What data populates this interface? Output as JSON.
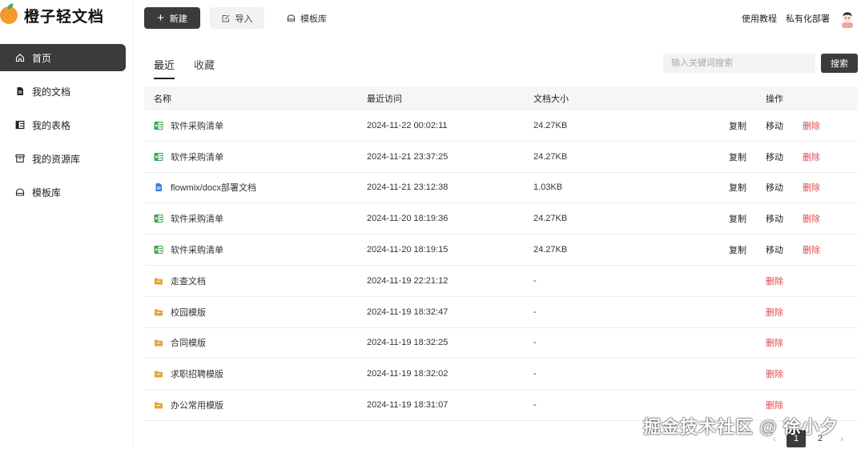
{
  "app": {
    "title": "橙子轻文档"
  },
  "sidebar": {
    "items": [
      {
        "label": "首页",
        "icon": "home-icon",
        "active": true
      },
      {
        "label": "我的文档",
        "icon": "document-icon",
        "active": false
      },
      {
        "label": "我的表格",
        "icon": "sheet-icon",
        "active": false
      },
      {
        "label": "我的资源库",
        "icon": "archive-icon",
        "active": false
      },
      {
        "label": "模板库",
        "icon": "template-icon",
        "active": false
      }
    ]
  },
  "toolbar": {
    "new_label": "新建",
    "import_label": "导入",
    "template_label": "模板库",
    "tutorial_label": "使用教程",
    "private_deploy_label": "私有化部署"
  },
  "tabs": [
    {
      "label": "最近",
      "active": true
    },
    {
      "label": "收藏",
      "active": false
    }
  ],
  "search": {
    "placeholder": "输入关键词搜索",
    "button_label": "搜索"
  },
  "table": {
    "headers": {
      "name": "名称",
      "time": "最近访问",
      "size": "文档大小",
      "ops": "操作"
    },
    "op_labels": {
      "copy": "复制",
      "move": "移动",
      "delete": "删除"
    },
    "rows": [
      {
        "type": "sheet",
        "name": "软件采购清单",
        "time": "2024-11-22 00:02:11",
        "size": "24.27KB",
        "full_ops": true
      },
      {
        "type": "sheet",
        "name": "软件采购清单",
        "time": "2024-11-21 23:37:25",
        "size": "24.27KB",
        "full_ops": true
      },
      {
        "type": "doc",
        "name": "flowmix/docx部署文档",
        "time": "2024-11-21 23:12:38",
        "size": "1.03KB",
        "full_ops": true
      },
      {
        "type": "sheet",
        "name": "软件采购清单",
        "time": "2024-11-20 18:19:36",
        "size": "24.27KB",
        "full_ops": true
      },
      {
        "type": "sheet",
        "name": "软件采购清单",
        "time": "2024-11-20 18:19:15",
        "size": "24.27KB",
        "full_ops": true
      },
      {
        "type": "folder",
        "name": "走查文档",
        "time": "2024-11-19 22:21:12",
        "size": "-",
        "full_ops": false
      },
      {
        "type": "folder",
        "name": "校园模版",
        "time": "2024-11-19 18:32:47",
        "size": "-",
        "full_ops": false
      },
      {
        "type": "folder",
        "name": "合同模版",
        "time": "2024-11-19 18:32:25",
        "size": "-",
        "full_ops": false
      },
      {
        "type": "folder",
        "name": "求职招聘模版",
        "time": "2024-11-19 18:32:02",
        "size": "-",
        "full_ops": false
      },
      {
        "type": "folder",
        "name": "办公常用模版",
        "time": "2024-11-19 18:31:07",
        "size": "-",
        "full_ops": false
      }
    ]
  },
  "pagination": {
    "pages": [
      "1",
      "2"
    ],
    "current": "1"
  },
  "watermark": "掘金技术社区 @ 徐小夕",
  "colors": {
    "primary": "#3b3b3b",
    "danger": "#e04848",
    "sheet": "#3aa54a",
    "doc": "#3b7de0",
    "folder": "#e8a33a"
  }
}
